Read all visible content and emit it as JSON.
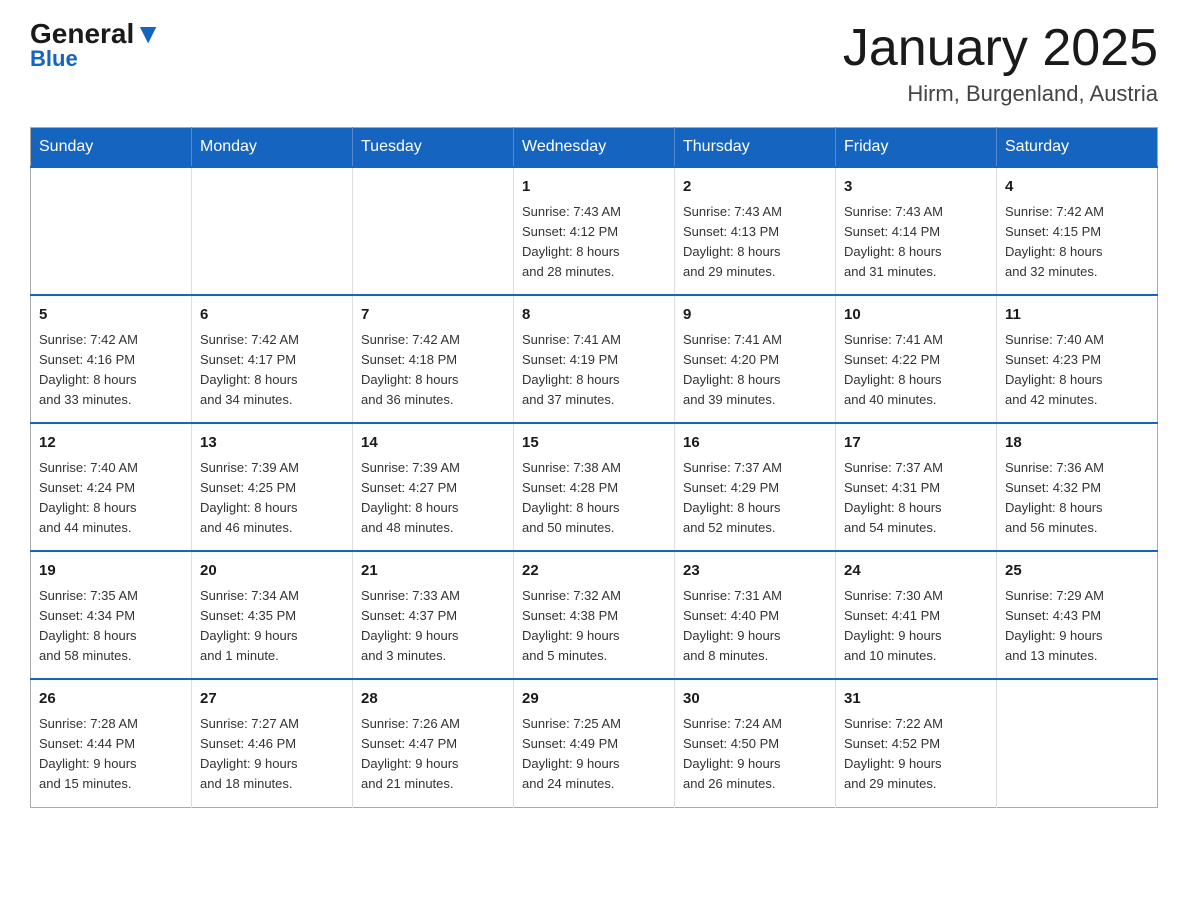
{
  "header": {
    "logo_general": "General",
    "logo_blue": "Blue",
    "title": "January 2025",
    "subtitle": "Hirm, Burgenland, Austria"
  },
  "weekdays": [
    "Sunday",
    "Monday",
    "Tuesday",
    "Wednesday",
    "Thursday",
    "Friday",
    "Saturday"
  ],
  "weeks": [
    [
      {
        "day": "",
        "info": ""
      },
      {
        "day": "",
        "info": ""
      },
      {
        "day": "",
        "info": ""
      },
      {
        "day": "1",
        "info": "Sunrise: 7:43 AM\nSunset: 4:12 PM\nDaylight: 8 hours\nand 28 minutes."
      },
      {
        "day": "2",
        "info": "Sunrise: 7:43 AM\nSunset: 4:13 PM\nDaylight: 8 hours\nand 29 minutes."
      },
      {
        "day": "3",
        "info": "Sunrise: 7:43 AM\nSunset: 4:14 PM\nDaylight: 8 hours\nand 31 minutes."
      },
      {
        "day": "4",
        "info": "Sunrise: 7:42 AM\nSunset: 4:15 PM\nDaylight: 8 hours\nand 32 minutes."
      }
    ],
    [
      {
        "day": "5",
        "info": "Sunrise: 7:42 AM\nSunset: 4:16 PM\nDaylight: 8 hours\nand 33 minutes."
      },
      {
        "day": "6",
        "info": "Sunrise: 7:42 AM\nSunset: 4:17 PM\nDaylight: 8 hours\nand 34 minutes."
      },
      {
        "day": "7",
        "info": "Sunrise: 7:42 AM\nSunset: 4:18 PM\nDaylight: 8 hours\nand 36 minutes."
      },
      {
        "day": "8",
        "info": "Sunrise: 7:41 AM\nSunset: 4:19 PM\nDaylight: 8 hours\nand 37 minutes."
      },
      {
        "day": "9",
        "info": "Sunrise: 7:41 AM\nSunset: 4:20 PM\nDaylight: 8 hours\nand 39 minutes."
      },
      {
        "day": "10",
        "info": "Sunrise: 7:41 AM\nSunset: 4:22 PM\nDaylight: 8 hours\nand 40 minutes."
      },
      {
        "day": "11",
        "info": "Sunrise: 7:40 AM\nSunset: 4:23 PM\nDaylight: 8 hours\nand 42 minutes."
      }
    ],
    [
      {
        "day": "12",
        "info": "Sunrise: 7:40 AM\nSunset: 4:24 PM\nDaylight: 8 hours\nand 44 minutes."
      },
      {
        "day": "13",
        "info": "Sunrise: 7:39 AM\nSunset: 4:25 PM\nDaylight: 8 hours\nand 46 minutes."
      },
      {
        "day": "14",
        "info": "Sunrise: 7:39 AM\nSunset: 4:27 PM\nDaylight: 8 hours\nand 48 minutes."
      },
      {
        "day": "15",
        "info": "Sunrise: 7:38 AM\nSunset: 4:28 PM\nDaylight: 8 hours\nand 50 minutes."
      },
      {
        "day": "16",
        "info": "Sunrise: 7:37 AM\nSunset: 4:29 PM\nDaylight: 8 hours\nand 52 minutes."
      },
      {
        "day": "17",
        "info": "Sunrise: 7:37 AM\nSunset: 4:31 PM\nDaylight: 8 hours\nand 54 minutes."
      },
      {
        "day": "18",
        "info": "Sunrise: 7:36 AM\nSunset: 4:32 PM\nDaylight: 8 hours\nand 56 minutes."
      }
    ],
    [
      {
        "day": "19",
        "info": "Sunrise: 7:35 AM\nSunset: 4:34 PM\nDaylight: 8 hours\nand 58 minutes."
      },
      {
        "day": "20",
        "info": "Sunrise: 7:34 AM\nSunset: 4:35 PM\nDaylight: 9 hours\nand 1 minute."
      },
      {
        "day": "21",
        "info": "Sunrise: 7:33 AM\nSunset: 4:37 PM\nDaylight: 9 hours\nand 3 minutes."
      },
      {
        "day": "22",
        "info": "Sunrise: 7:32 AM\nSunset: 4:38 PM\nDaylight: 9 hours\nand 5 minutes."
      },
      {
        "day": "23",
        "info": "Sunrise: 7:31 AM\nSunset: 4:40 PM\nDaylight: 9 hours\nand 8 minutes."
      },
      {
        "day": "24",
        "info": "Sunrise: 7:30 AM\nSunset: 4:41 PM\nDaylight: 9 hours\nand 10 minutes."
      },
      {
        "day": "25",
        "info": "Sunrise: 7:29 AM\nSunset: 4:43 PM\nDaylight: 9 hours\nand 13 minutes."
      }
    ],
    [
      {
        "day": "26",
        "info": "Sunrise: 7:28 AM\nSunset: 4:44 PM\nDaylight: 9 hours\nand 15 minutes."
      },
      {
        "day": "27",
        "info": "Sunrise: 7:27 AM\nSunset: 4:46 PM\nDaylight: 9 hours\nand 18 minutes."
      },
      {
        "day": "28",
        "info": "Sunrise: 7:26 AM\nSunset: 4:47 PM\nDaylight: 9 hours\nand 21 minutes."
      },
      {
        "day": "29",
        "info": "Sunrise: 7:25 AM\nSunset: 4:49 PM\nDaylight: 9 hours\nand 24 minutes."
      },
      {
        "day": "30",
        "info": "Sunrise: 7:24 AM\nSunset: 4:50 PM\nDaylight: 9 hours\nand 26 minutes."
      },
      {
        "day": "31",
        "info": "Sunrise: 7:22 AM\nSunset: 4:52 PM\nDaylight: 9 hours\nand 29 minutes."
      },
      {
        "day": "",
        "info": ""
      }
    ]
  ]
}
